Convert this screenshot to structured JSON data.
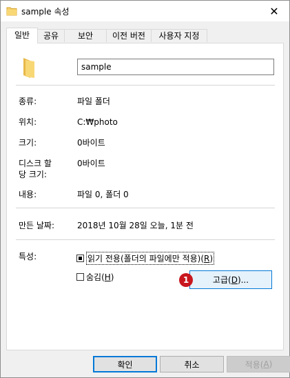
{
  "window": {
    "title": "sample 속성",
    "close_glyph": "✕"
  },
  "tabs": [
    {
      "label": "일반",
      "active": true
    },
    {
      "label": "공유"
    },
    {
      "label": "보안"
    },
    {
      "label": "이전 버전"
    },
    {
      "label": "사용자 지정"
    }
  ],
  "general": {
    "name_value": "sample",
    "type_label": "종류:",
    "type_value": "파일 폴더",
    "location_label": "위치:",
    "location_value": "C:₩photo",
    "size_label": "크기:",
    "size_value": "0바이트",
    "disk_size_label_line1": "디스크 할",
    "disk_size_label_line2": "당 크기:",
    "disk_size_value": "0바이트",
    "contains_label": "내용:",
    "contains_value": "파일 0, 폴더 0",
    "created_label": "만든 날짜:",
    "created_value": "2018년 10월 28일 오늘, 1분 전",
    "attributes_label": "특성:",
    "readonly_text": "읽기 전용(폴더의 파일에만 적용)(",
    "readonly_key": "R",
    "readonly_close": ")",
    "hidden_text": "숨김(",
    "hidden_key": "H",
    "hidden_close": ")",
    "advanced_text": "고급(",
    "advanced_key": "D",
    "advanced_close": ")...",
    "badge": "1"
  },
  "buttons": {
    "ok": "확인",
    "cancel": "취소",
    "apply_text": "적용(",
    "apply_key": "A",
    "apply_close": ")"
  },
  "colors": {
    "accent": "#0078d7",
    "badge": "#c9171f",
    "folder": "#f5cf6b"
  },
  "icons": {
    "title": "folder-icon",
    "large": "folder-icon",
    "close": "close-icon"
  }
}
